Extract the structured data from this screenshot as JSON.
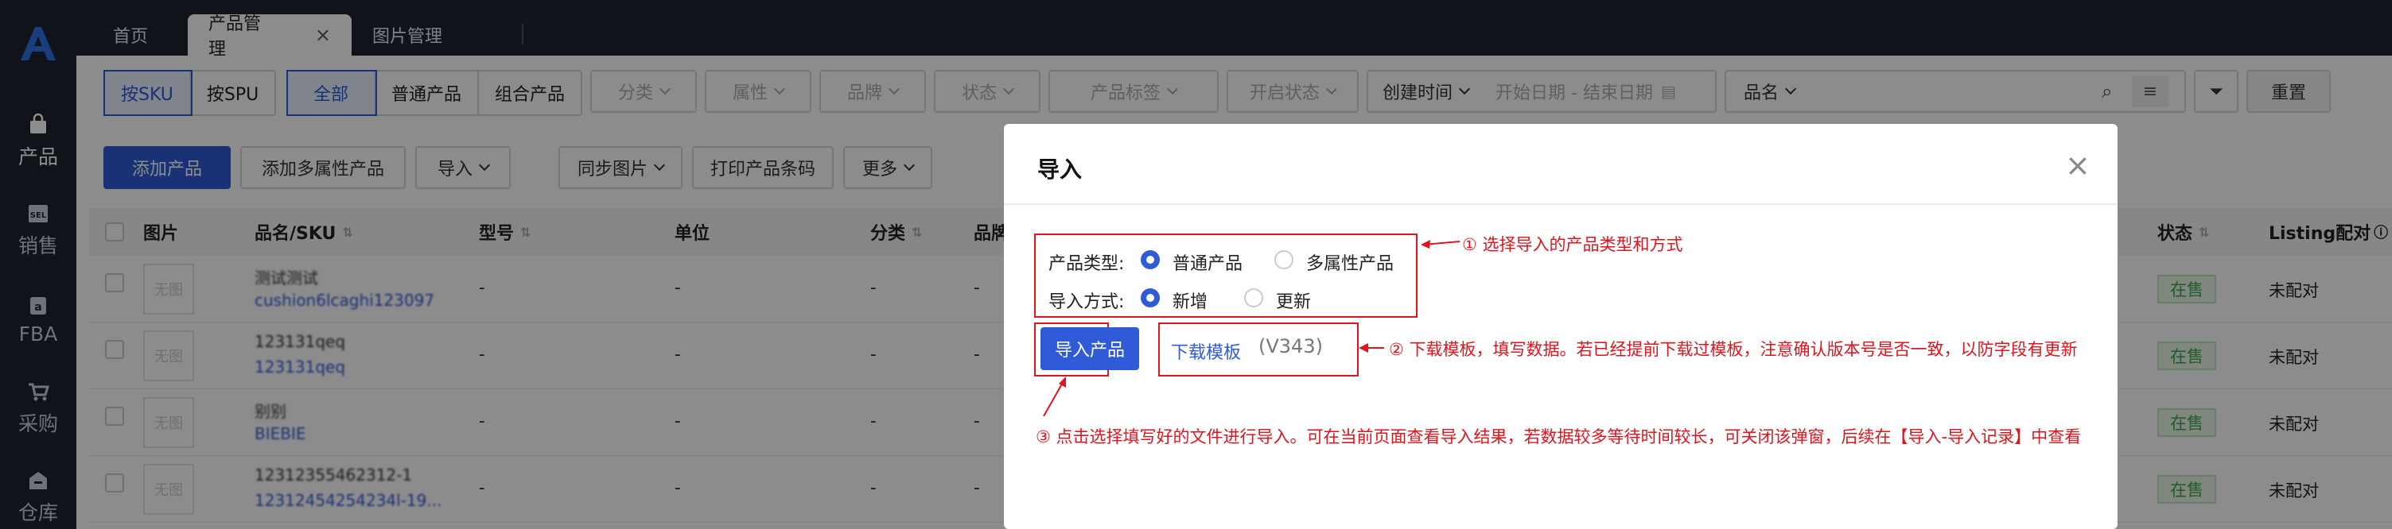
{
  "sidebar": {
    "items": [
      {
        "label": "产品",
        "icon": "bag-icon"
      },
      {
        "label": "销售",
        "icon": "sel-icon"
      },
      {
        "label": "FBA",
        "icon": "amazon-icon"
      },
      {
        "label": "采购",
        "icon": "cart-icon"
      },
      {
        "label": "仓库",
        "icon": "warehouse-icon"
      }
    ]
  },
  "tabs": {
    "home": "首页",
    "product": "产品管理",
    "image": "图片管理",
    "close": "×"
  },
  "filters": {
    "sku": "按SKU",
    "spu": "按SPU",
    "all": "全部",
    "normal": "普通产品",
    "combo": "组合产品",
    "category": "分类",
    "attribute": "属性",
    "brand": "品牌",
    "status": "状态",
    "tag": "产品标签",
    "enable": "开启状态",
    "created": "创建时间",
    "date_range": "开始日期 - 结束日期",
    "name_field": "品名",
    "reset": "重置"
  },
  "actions": {
    "add": "添加产品",
    "add_multi": "添加多属性产品",
    "import": "导入",
    "sync": "同步图片",
    "print": "打印产品条码",
    "more": "更多"
  },
  "table": {
    "headers": {
      "image": "图片",
      "name_sku": "品名/SKU",
      "model": "型号",
      "unit": "单位",
      "category": "分类",
      "brand": "品牌",
      "status": "状态",
      "listing": "Listing配对"
    },
    "placeholder": "无图",
    "rows": [
      {
        "name": "测试测试",
        "sku": "cushion6lcaghi123097",
        "model": "-",
        "unit": "-",
        "cat": "-",
        "brand": "-",
        "status": "在售",
        "listing": "未配对"
      },
      {
        "name": "123131qeq",
        "sku": "123131qeq",
        "model": "-",
        "unit": "-",
        "cat": "-",
        "brand": "-",
        "status": "在售",
        "listing": "未配对"
      },
      {
        "name": "别别",
        "sku": "BIEBIE",
        "model": "-",
        "unit": "-",
        "cat": "-",
        "brand": "-",
        "status": "在售",
        "listing": "未配对"
      },
      {
        "name": "12312355462312-1",
        "sku": "12312454254234l-19...",
        "model": "-",
        "unit": "-",
        "cat": "-",
        "brand": "-",
        "status": "在售",
        "listing": "未配对"
      }
    ]
  },
  "modal": {
    "title": "导入",
    "close": "×",
    "type_label": "产品类型:",
    "type_normal": "普通产品",
    "type_multi": "多属性产品",
    "mode_label": "导入方式:",
    "mode_new": "新增",
    "mode_update": "更新",
    "import_button": "导入产品",
    "download_link": "下载模板",
    "version": "(V343)"
  },
  "annotations": {
    "a1": "① 选择导入的产品类型和方式",
    "a2": "② 下载模板，填写数据。若已经提前下载过模板，注意确认版本号是否一致，以防字段有更新",
    "a3": "③ 点击选择填写好的文件进行导入。可在当前页面查看导入结果，若数据较多等待时间较长，可关闭该弹窗，后续在【导入-导入记录】中查看"
  },
  "colors": {
    "accent": "#2f5bd8",
    "sidebar": "#1e2530",
    "annotation": "#e0141e",
    "onsale": "#3aa84a"
  }
}
